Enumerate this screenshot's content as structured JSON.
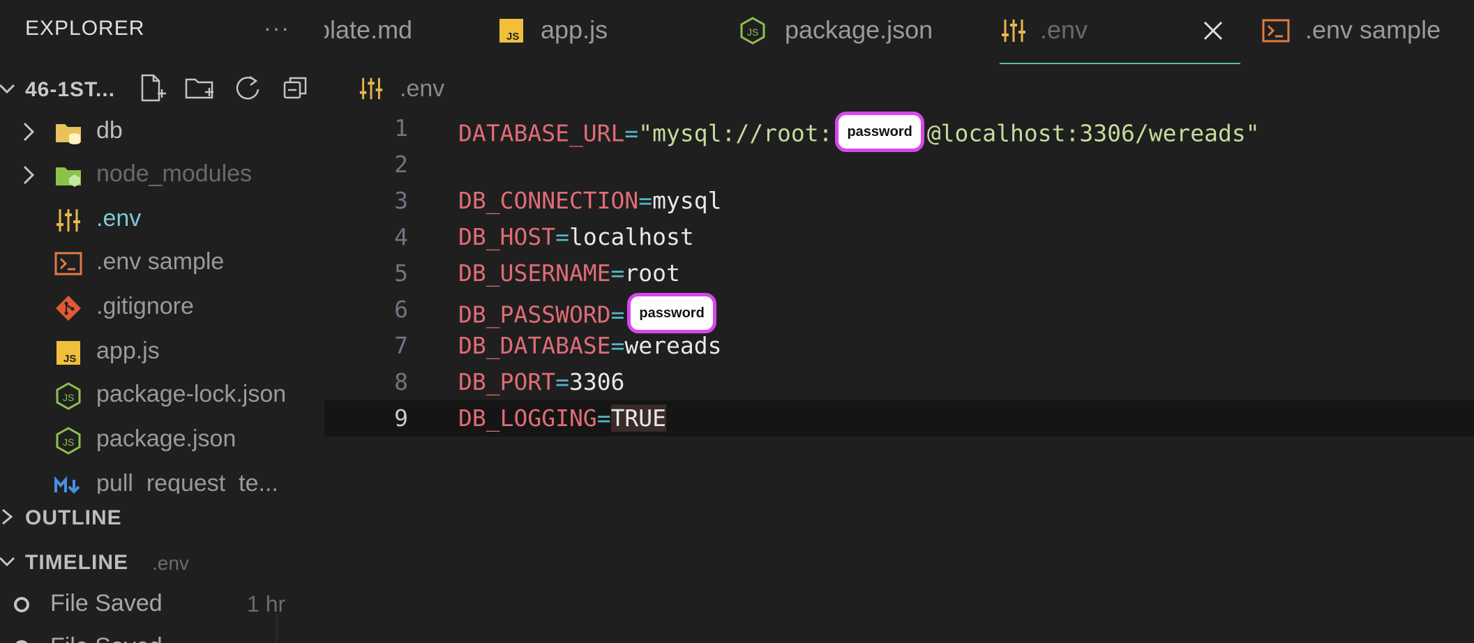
{
  "explorer": {
    "title": "EXPLORER",
    "more": "···",
    "folder_title": "46-1ST...",
    "items": [
      {
        "name": "db",
        "kind": "folder",
        "color": "#e8c25a"
      },
      {
        "name": "node_modules",
        "kind": "folder",
        "color": "#8bc34a"
      },
      {
        "name": ".env",
        "kind": "env",
        "color": "#e8b84a"
      },
      {
        "name": ".env sample",
        "kind": "terminal",
        "color": "#e27b45"
      },
      {
        "name": ".gitignore",
        "kind": "git",
        "color": "#e25a34"
      },
      {
        "name": "app.js",
        "kind": "js",
        "color": "#f0c03a"
      },
      {
        "name": "package-lock.json",
        "kind": "node",
        "color": "#8cc152"
      },
      {
        "name": "package.json",
        "kind": "node",
        "color": "#8cc152"
      },
      {
        "name": "pull_request_te...",
        "kind": "markdown",
        "color": "#4a90e2"
      }
    ]
  },
  "outline": {
    "title": "OUTLINE"
  },
  "timeline": {
    "title": "TIMELINE",
    "file": ".env",
    "entries": [
      {
        "label": "File Saved",
        "time": "1 hr"
      },
      {
        "label": "File Saved",
        "time": ""
      }
    ]
  },
  "tabs": [
    {
      "label": "plate.md",
      "icon": "none"
    },
    {
      "label": "app.js",
      "icon": "js-icon"
    },
    {
      "label": "package.json",
      "icon": "node-icon"
    },
    {
      "label": ".env",
      "icon": "env-icon",
      "active": true
    },
    {
      "label": ".env sample",
      "icon": "terminal-icon"
    }
  ],
  "breadcrumb": {
    "file": ".env"
  },
  "code": {
    "lines": [
      {
        "n": "1",
        "key": "DATABASE_URL",
        "eq": "=",
        "pre": "\"mysql://root:",
        "badge": "password",
        "post": "@localhost:3306/wereads\"",
        "type": "string"
      },
      {
        "n": "2",
        "key": "",
        "eq": "",
        "value": "",
        "type": "empty"
      },
      {
        "n": "3",
        "key": "DB_CONNECTION",
        "eq": "=",
        "value": "mysql",
        "type": "plain"
      },
      {
        "n": "4",
        "key": "DB_HOST",
        "eq": "=",
        "value": "localhost",
        "type": "plain"
      },
      {
        "n": "5",
        "key": "DB_USERNAME",
        "eq": "=",
        "value": "root",
        "type": "plain"
      },
      {
        "n": "6",
        "key": "DB_PASSWORD",
        "eq": "=",
        "badge": "password",
        "type": "badge"
      },
      {
        "n": "7",
        "key": "DB_DATABASE",
        "eq": "=",
        "value": "wereads",
        "type": "plain"
      },
      {
        "n": "8",
        "key": "DB_PORT",
        "eq": "=",
        "value": "3306",
        "type": "plain"
      },
      {
        "n": "9",
        "key": "DB_LOGGING",
        "eq": "=",
        "value": "TRUE",
        "type": "plain",
        "current": true
      }
    ]
  },
  "colors": {
    "accent": "#5fb9a8",
    "badge_border": "#d946ef",
    "key": "#e06c75",
    "string": "#c6dc9c"
  }
}
